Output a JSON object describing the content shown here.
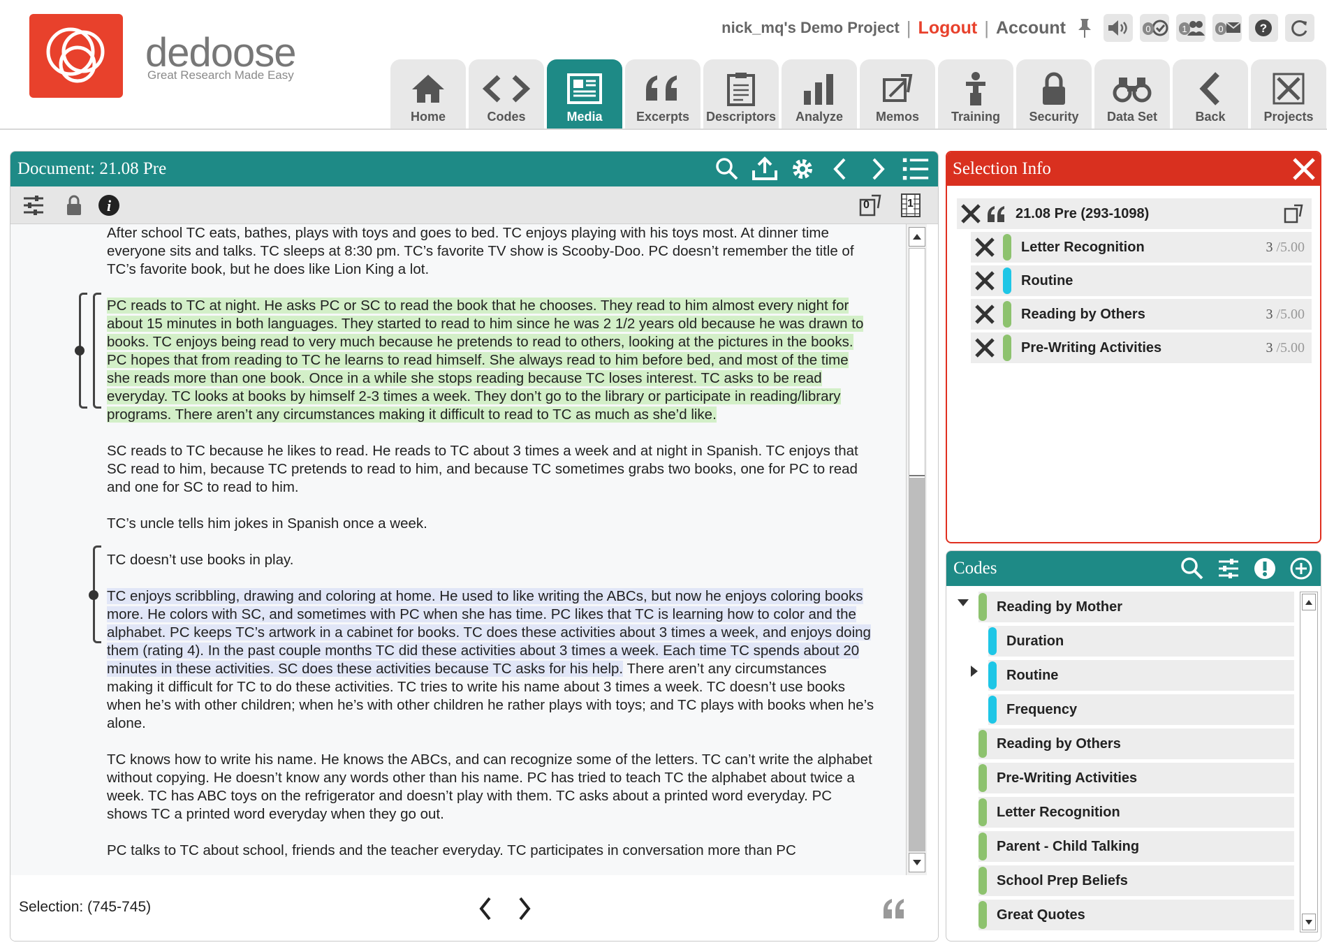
{
  "brand": {
    "name": "dedoose",
    "tagline": "Great Research Made Easy",
    "color": "#e8412c"
  },
  "topbar": {
    "project": "nick_mq's Demo Project",
    "separator": "|",
    "logout": "Logout",
    "account": "Account",
    "badges": {
      "review": "0",
      "users": "1",
      "messages": "0"
    }
  },
  "nav": {
    "home": "Home",
    "codes": "Codes",
    "media": "Media",
    "excerpts": "Excerpts",
    "descriptors": "Descriptors",
    "analyze": "Analyze",
    "memos": "Memos",
    "training": "Training",
    "security": "Security",
    "dataset": "Data Set",
    "back": "Back",
    "projects": "Projects",
    "active": "Media",
    "accent_color": "#1e8a86"
  },
  "document": {
    "title": "Document: 21.08 Pre",
    "memo_count": "0",
    "page_number": "1",
    "paragraphs": {
      "p1": "After school TC eats, bathes, plays with toys and goes to bed.  TC enjoys playing with his toys most.  At dinner time everyone sits and talks.  TC sleeps at 8:30 pm.  TC’s favorite TV show is Scooby-Doo.  PC doesn’t remember the title of TC’s favorite book, but he does like Lion King a lot.",
      "p2": "PC reads to TC at night.  He asks PC or SC to read the book that he chooses.  They read to him almost every night for about 15 minutes in both languages.  They started to read to him since he was 2 1/2 years old because he was drawn to books.  TC enjoys being read to very much because he pretends to read to others, looking at the pictures in the books.  PC hopes that from reading to TC he learns to read himself.  She always read to him before bed, and most of the time she reads more than one book.  Once in a while she stops reading because TC loses interest.  TC asks to be read everyday.  TC looks at books by himself 2-3 times a week.  They don’t go to the library or participate in reading/library programs.  There aren’t any circumstances making it difficult to read to TC as much as she’d like.",
      "p3": "SC reads to TC because he likes to read.  He reads to TC about 3 times a week and at night in Spanish.  TC enjoys that SC read to him, because TC pretends to read to him, and because TC sometimes grabs two books, one for PC to read and one for SC to read to him.",
      "p4": "TC’s uncle tells him jokes in Spanish once a week.",
      "p5": "TC doesn’t use books in play.",
      "p6_highlight": "TC enjoys scribbling, drawing and coloring at home.  He used to like writing the ABCs, but now he enjoys coloring books more.  He colors with SC, and sometimes with PC when she has time.  PC likes that TC is learning how to color  and the alphabet.  PC keeps TC’s artwork in a cabinet for books.  TC does these activities about 3 times a week, and enjoys doing them (rating 4).  In the past couple months TC did these activities about 3 times a week.  Each time TC spends about 20 minutes in these activities.  SC does these activities because TC asks for his help.",
      "p6_rest": "  There aren’t any circumstances making it difficult for TC to do these activities.  TC tries to write his name about 3 times a week.  TC doesn’t use books when he’s with other children; when he’s with other children he rather plays with toys; and TC plays with books when he’s alone.",
      "p7": "TC knows how to write his name.  He knows the ABCs, and can recognize some of the letters.  TC can’t write the alphabet without copying.  He doesn’t know any words other than his name.  PC has tried to teach TC the alphabet about twice a week.  TC has ABC toys on the refrigerator and doesn’t play with them.  TC asks about a printed word everyday.  PC shows TC a printed word everyday when they go out.",
      "p8": "PC talks to TC about school, friends and the teacher everyday.  TC participates in conversation more than PC"
    },
    "highlight_colors": {
      "green": "#d3efc8",
      "blue": "#e1e6f7"
    },
    "selection": "Selection: (745-745)"
  },
  "selection_info": {
    "title": "Selection Info",
    "excerpt": "21.08 Pre (293-1098)",
    "codes": [
      {
        "label": "Letter Recognition",
        "weight": "3",
        "max": " /5.00",
        "color": "#8dc26e"
      },
      {
        "label": "Routine",
        "weight": "",
        "max": "",
        "color": "#1ec6e6"
      },
      {
        "label": "Reading by Others",
        "weight": "3",
        "max": " /5.00",
        "color": "#8dc26e"
      },
      {
        "label": "Pre-Writing Activities",
        "weight": "3",
        "max": " /5.00",
        "color": "#8dc26e"
      }
    ]
  },
  "codes_panel": {
    "title": "Codes",
    "items": [
      {
        "label": "Reading by Mother",
        "color": "#8dc26e"
      },
      {
        "label": "Duration",
        "color": "#1ec6e6"
      },
      {
        "label": "Routine",
        "color": "#1ec6e6"
      },
      {
        "label": "Frequency",
        "color": "#1ec6e6"
      },
      {
        "label": "Reading by Others",
        "color": "#8dc26e"
      },
      {
        "label": "Pre-Writing Activities",
        "color": "#8dc26e"
      },
      {
        "label": "Letter Recognition",
        "color": "#8dc26e"
      },
      {
        "label": "Parent - Child Talking",
        "color": "#8dc26e"
      },
      {
        "label": "School Prep Beliefs",
        "color": "#8dc26e"
      },
      {
        "label": "Great Quotes",
        "color": "#8dc26e"
      }
    ]
  }
}
